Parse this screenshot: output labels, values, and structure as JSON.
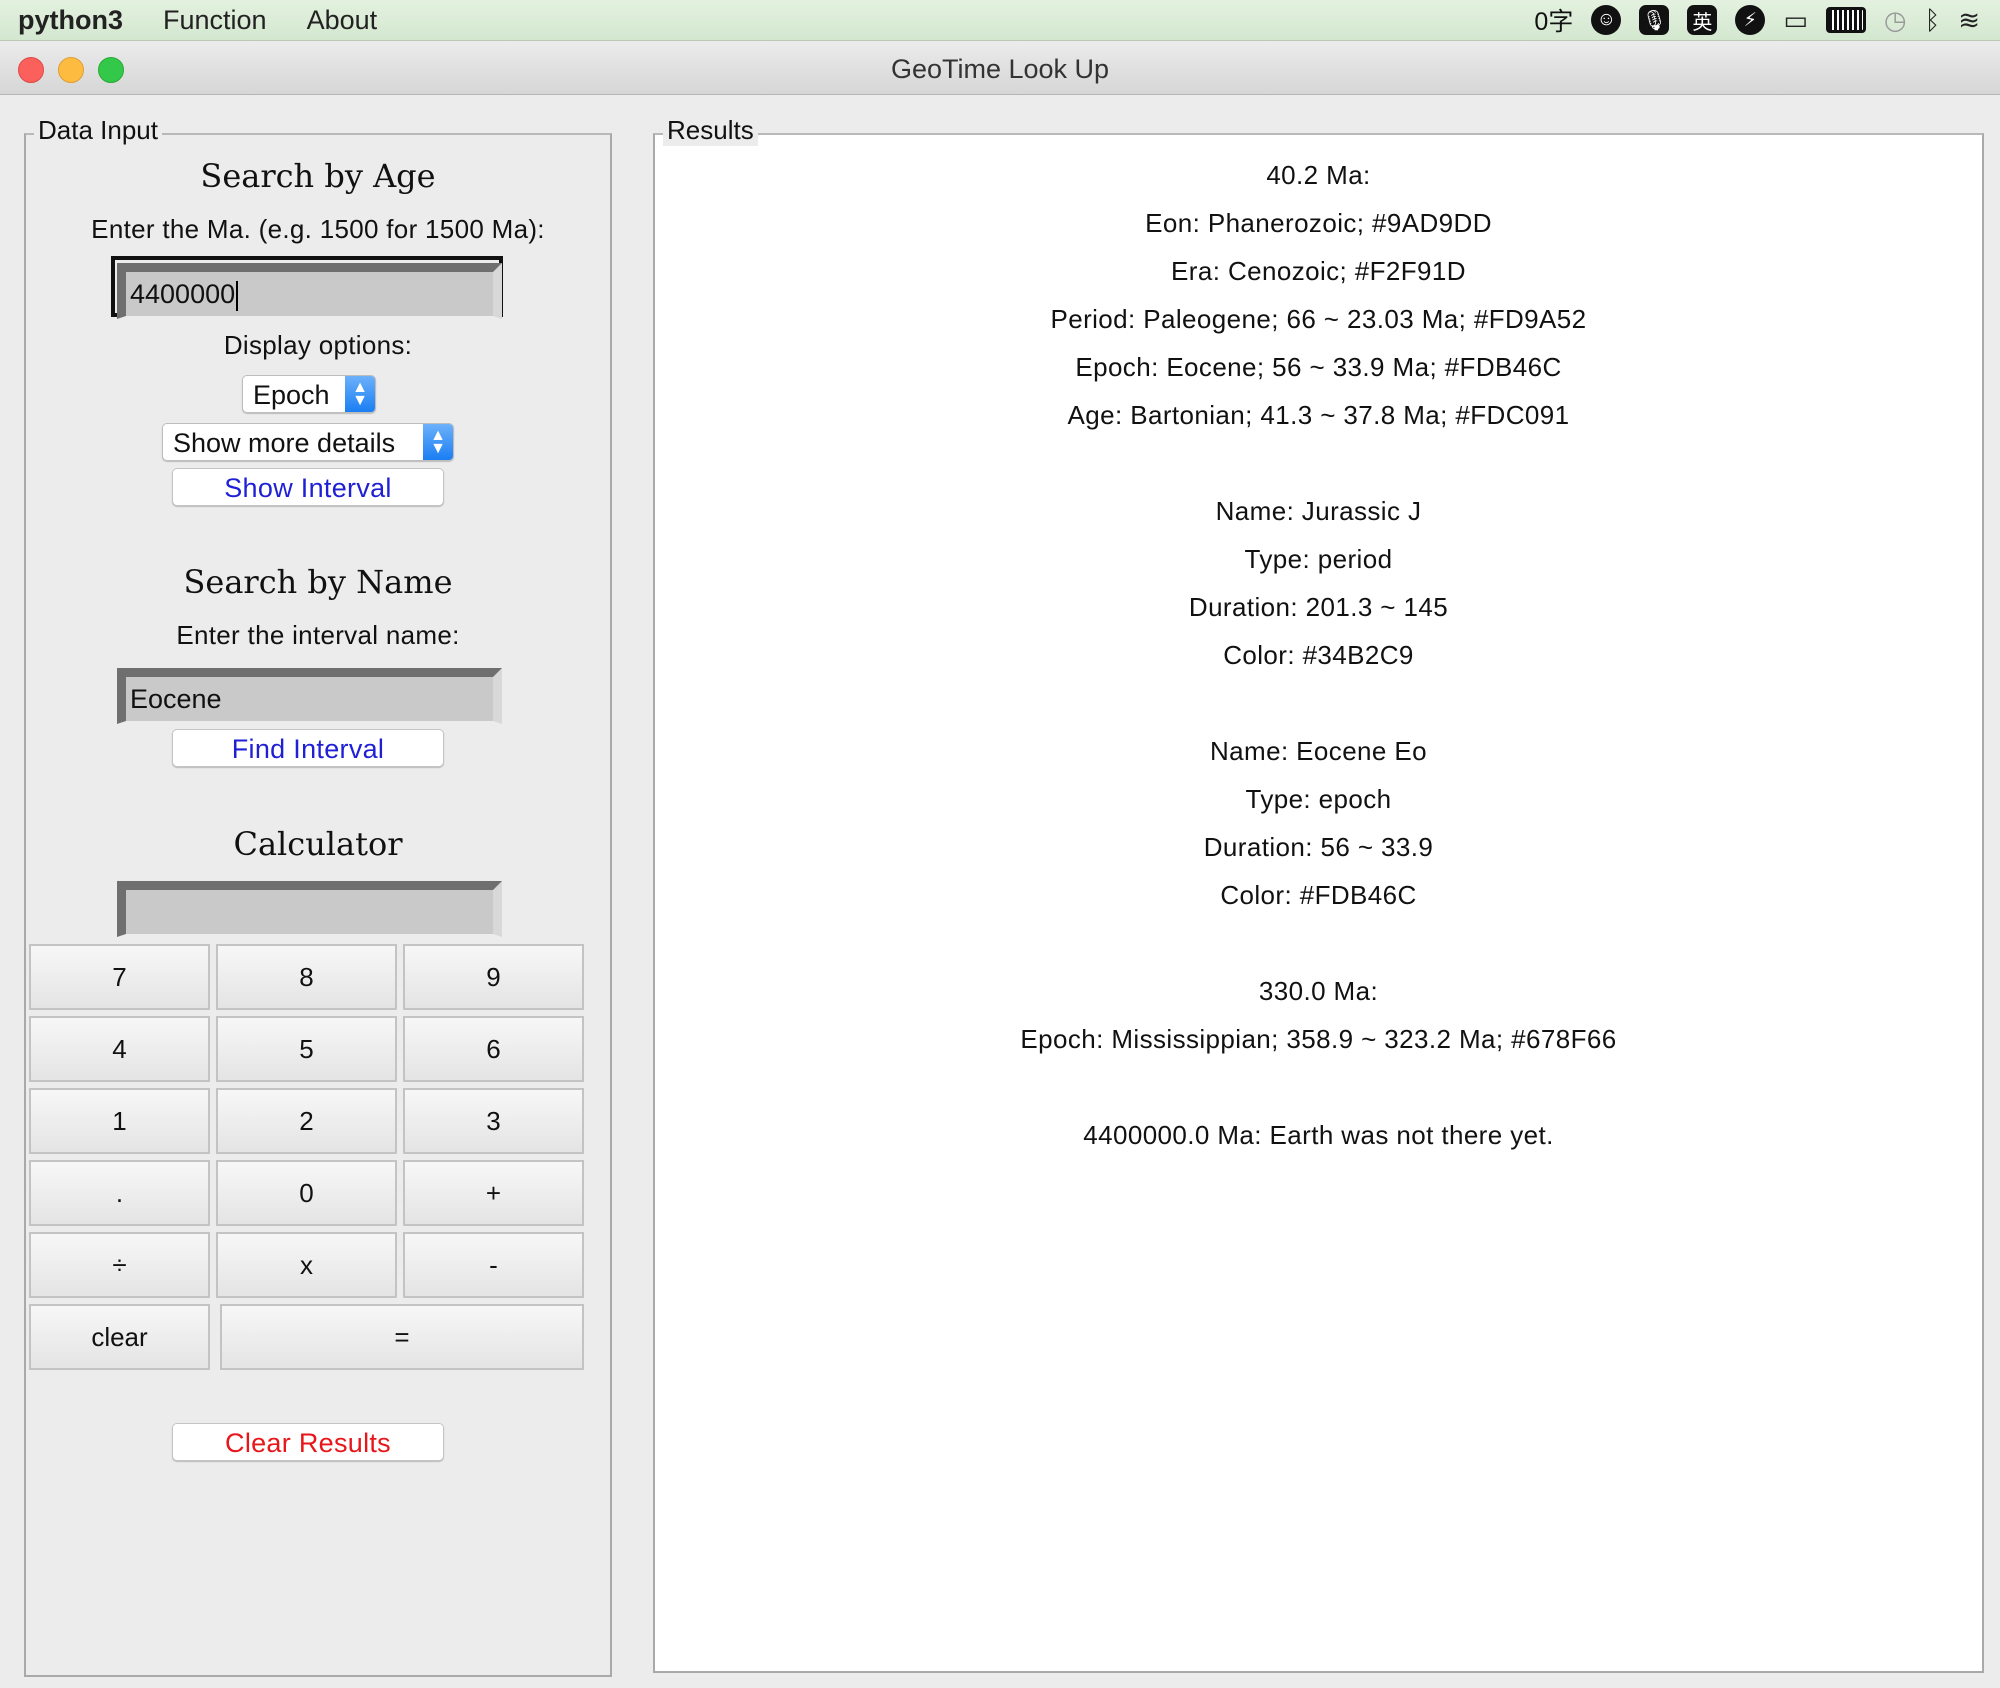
{
  "menubar": {
    "app": "python3",
    "menus": [
      "Function",
      "About"
    ],
    "tray": {
      "char_count": "0字",
      "emoji_icon": "☺",
      "mic_icon": "🎙",
      "ime": "英",
      "bolt_icon": "⚡",
      "airplay_icon": "▭",
      "clock_icon": "◷",
      "bluetooth_icon": "ᛒ",
      "wifi_icon": "≋"
    }
  },
  "window": {
    "title": "GeoTime Look Up"
  },
  "data_input": {
    "group_label": "Data Input",
    "search_age": {
      "heading": "Search by Age",
      "prompt": "Enter the Ma. (e.g. 1500 for 1500 Ma):",
      "value": "4400000",
      "display_options_label": "Display options:",
      "level_select": "Epoch",
      "detail_select": "Show more details",
      "show_button": "Show Interval"
    },
    "search_name": {
      "heading": "Search by Name",
      "prompt": "Enter the interval name:",
      "value": "Eocene",
      "find_button": "Find Interval"
    },
    "calculator": {
      "heading": "Calculator",
      "display": "",
      "keys": [
        "7",
        "8",
        "9",
        "4",
        "5",
        "6",
        "1",
        "2",
        "3",
        ".",
        "0",
        "+",
        "÷",
        "x",
        "-"
      ],
      "clear": "clear",
      "equals": "="
    },
    "clear_results_button": "Clear Results"
  },
  "results": {
    "group_label": "Results",
    "lines": [
      "40.2 Ma:",
      "Eon: Phanerozoic; #9AD9DD",
      "Era: Cenozoic; #F2F91D",
      "Period: Paleogene; 66 ~ 23.03 Ma; #FD9A52",
      "Epoch: Eocene; 56 ~ 33.9 Ma; #FDB46C",
      "Age: Bartonian; 41.3 ~ 37.8 Ma; #FDC091",
      "",
      "Name: Jurassic J",
      "Type: period",
      "Duration: 201.3 ~ 145",
      "Color: #34B2C9",
      "",
      "Name: Eocene Eo",
      "Type: epoch",
      "Duration: 56 ~ 33.9",
      "Color: #FDB46C",
      "",
      "330.0 Ma:",
      "Epoch: Mississippian; 358.9 ~ 323.2 Ma; #678F66",
      "",
      "4400000.0 Ma: Earth was not there yet."
    ]
  },
  "colors": {
    "link_blue": "#1f1fd6",
    "danger_red": "#e8161a",
    "close": "#fc605c",
    "minimize": "#fdbc40",
    "maximize": "#34c84a"
  }
}
